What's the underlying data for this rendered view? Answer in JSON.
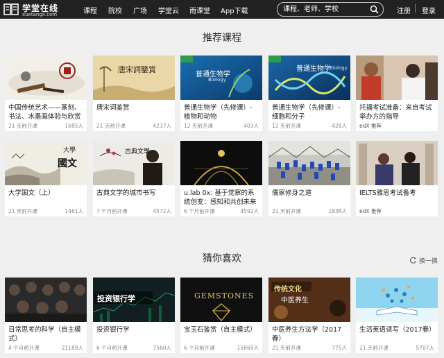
{
  "header": {
    "logo_title": "学堂在线",
    "logo_subtitle": "xuetangx.com",
    "nav": [
      "课程",
      "院校",
      "广场",
      "学堂云",
      "雨课堂",
      "App下载"
    ],
    "search_placeholder": "课程、老师、学校",
    "login": "注册",
    "register": "登录"
  },
  "recommended": {
    "title": "推荐课程",
    "courses": [
      {
        "title": "中国传统艺术——篆刻、书法、水墨画体验与欣赏",
        "meta": "21 天前开课",
        "count": "1685人"
      },
      {
        "title": "唐宋词鉴赏",
        "meta": "21 天前开课",
        "count": "4237人",
        "thumb_text": "唐宋詞鑒賞"
      },
      {
        "title": "普通生物学（先修课）- 植物和动物",
        "meta": "12 天前开课",
        "count": "403人",
        "thumb_text": "普通生物学",
        "thumb_sub": "Biology"
      },
      {
        "title": "普通生物学（先修课）- 细胞和分子",
        "meta": "12 天前开课",
        "count": "428人",
        "thumb_text": "普通生物学",
        "thumb_sub": "Biology"
      },
      {
        "title": "托福考试准备：来自考试举办方的指导",
        "meta": "",
        "count": "",
        "source": "edX 推荐"
      },
      {
        "title": "大学国文（上）",
        "meta": "21 天前开课",
        "count": "1461人",
        "thumb_text": "大學",
        "thumb_text2": "國文"
      },
      {
        "title": "古典文学的城市书写",
        "meta": "7 个月前开课",
        "count": "4572人",
        "thumb_text": "古典文學"
      },
      {
        "title": "u.lab 0x: 基于觉察的系统创变：感知和共创未来",
        "meta": "6 个月前开课",
        "count": "4592人"
      },
      {
        "title": "儒家修身之道",
        "meta": "21 天前开课",
        "count": "1838人"
      },
      {
        "title": "IELTS雅思考试备考",
        "meta": "",
        "count": "",
        "source": "edX 推荐"
      }
    ]
  },
  "guess": {
    "title": "猜你喜欢",
    "refresh_label": "换一换",
    "courses": [
      {
        "title": "日常思考的科学（自主模式）",
        "meta": "4 个月前开课",
        "count": "21189人"
      },
      {
        "title": "投资银行学",
        "meta": "6 个月前开课",
        "count": "7560人",
        "thumb_text": "投资银行学"
      },
      {
        "title": "宝玉石鉴赏（自主模式）",
        "meta": "6 个月前开课",
        "count": "15869人",
        "thumb_text": "GEMSTONES"
      },
      {
        "title": "中医养生方法学（2017春）",
        "meta": "21 天前开课",
        "count": "775人",
        "thumb_text": "传统文化",
        "thumb_text2": "中医养生"
      },
      {
        "title": "生活英语读写（2017春）",
        "meta": "21 天前开课",
        "count": "5707人"
      }
    ]
  }
}
